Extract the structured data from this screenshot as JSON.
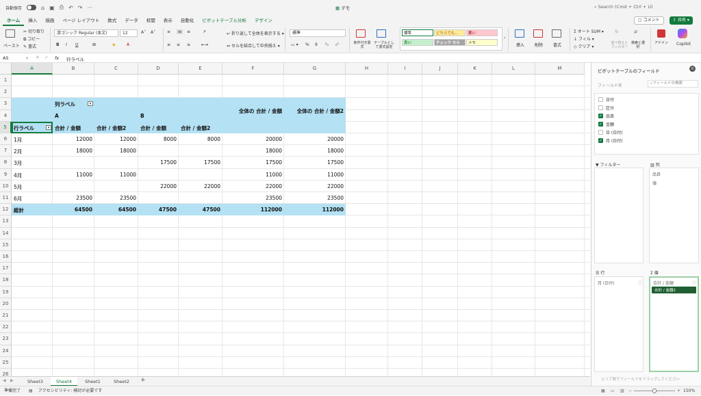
{
  "titlebar": {
    "autosave": "自動保存",
    "title": "デモ",
    "search": "Search (Cmd + Ctrl + U)"
  },
  "tabs": [
    "ホーム",
    "挿入",
    "描画",
    "ページ レイアウト",
    "数式",
    "データ",
    "校閲",
    "表示",
    "自動化",
    "ピボットテーブル分析",
    "デザイン"
  ],
  "actions": {
    "comment": "コメント",
    "share": "共有"
  },
  "ribbon": {
    "paste": "ペースト",
    "cut": "切り取り",
    "copy": "コピー",
    "format": "書式",
    "font": "游ゴシック Regular (本文)",
    "size": "12",
    "wrap": "折り返して全体を表示する",
    "merge": "セルを結合して中央揃え",
    "number_format": "標準",
    "cond_format": "条件付き書式",
    "table_format": "テーブルとして書式設定",
    "styles": {
      "standard": "標準",
      "neutral": "どちらでも...",
      "bad": "悪い",
      "good": "良い",
      "check": "チェック セル",
      "memo": "メモ"
    },
    "insert": "挿入",
    "delete": "削除",
    "cell_format": "書式",
    "autosum": "オート SUM",
    "fill": "フィル",
    "clear": "クリア",
    "sort": "並べ替えとフィルター",
    "find": "検索と選択",
    "addin": "アドイン",
    "copilot": "Copilot"
  },
  "formula_bar": {
    "cell_ref": "A5",
    "fx": "fx",
    "content": "行ラベル"
  },
  "columns": [
    "A",
    "B",
    "C",
    "D",
    "E",
    "F",
    "G",
    "H",
    "I",
    "J",
    "K",
    "L",
    "M"
  ],
  "rows": [
    "1",
    "2",
    "3",
    "4",
    "5",
    "6",
    "7",
    "8",
    "9",
    "10",
    "11",
    "12",
    "13",
    "14",
    "15",
    "16",
    "17",
    "18",
    "19",
    "20",
    "21",
    "22",
    "23",
    "24",
    "25",
    "26"
  ],
  "pivot": {
    "col_label": "列ラベル",
    "groups": [
      "A",
      "B"
    ],
    "row_label": "行ラベル",
    "headers": [
      "合計 / 金額",
      "合計 / 金額2",
      "合計 / 金額",
      "合計 / 金額2",
      "全体の 合計 / 金額",
      "全体の 合計 / 金額2"
    ],
    "data": [
      [
        "1月",
        "12000",
        "12000",
        "8000",
        "8000",
        "20000",
        "20000"
      ],
      [
        "2月",
        "18000",
        "18000",
        "",
        "",
        "18000",
        "18000"
      ],
      [
        "3月",
        "",
        "",
        "17500",
        "17500",
        "17500",
        "17500"
      ],
      [
        "4月",
        "11000",
        "11000",
        "",
        "",
        "11000",
        "11000"
      ],
      [
        "5月",
        "",
        "",
        "22000",
        "22000",
        "22000",
        "22000"
      ],
      [
        "6月",
        "23500",
        "23500",
        "",
        "",
        "23500",
        "23500"
      ]
    ],
    "total": [
      "総計",
      "64500",
      "64500",
      "47500",
      "47500",
      "112000",
      "112000"
    ]
  },
  "sheets": [
    "Sheet3",
    "Sheet4",
    "Sheet1",
    "Sheet2"
  ],
  "active_sheet": "Sheet4",
  "status": {
    "ready": "準備完了",
    "accessibility": "アクセシビリティ: 検討が必要です",
    "zoom": "150%"
  },
  "pane": {
    "title": "ピボットテーブルのフィールド",
    "field_name": "フィールド名",
    "search_placeholder": "フィールドの検索",
    "fields": [
      {
        "name": "日付",
        "checked": false
      },
      {
        "name": "区分",
        "checked": false
      },
      {
        "name": "品目",
        "checked": true
      },
      {
        "name": "金額",
        "checked": true
      },
      {
        "name": "日 (日付)",
        "checked": false
      },
      {
        "name": "月 (日付)",
        "checked": true
      }
    ],
    "filter_label": "フィルター",
    "columns_label": "列",
    "column_items": [
      "品目",
      "値"
    ],
    "rows_label": "行",
    "row_items": [
      "月 (日付)"
    ],
    "values_label": "値",
    "value_items": [
      "合計 / 金額",
      "合計 / 金額2"
    ],
    "hint": "エリア間でフィールドをドラッグしてください"
  },
  "colors": {
    "accent": "#137a3e",
    "pivot_header": "#b4e1f3"
  }
}
